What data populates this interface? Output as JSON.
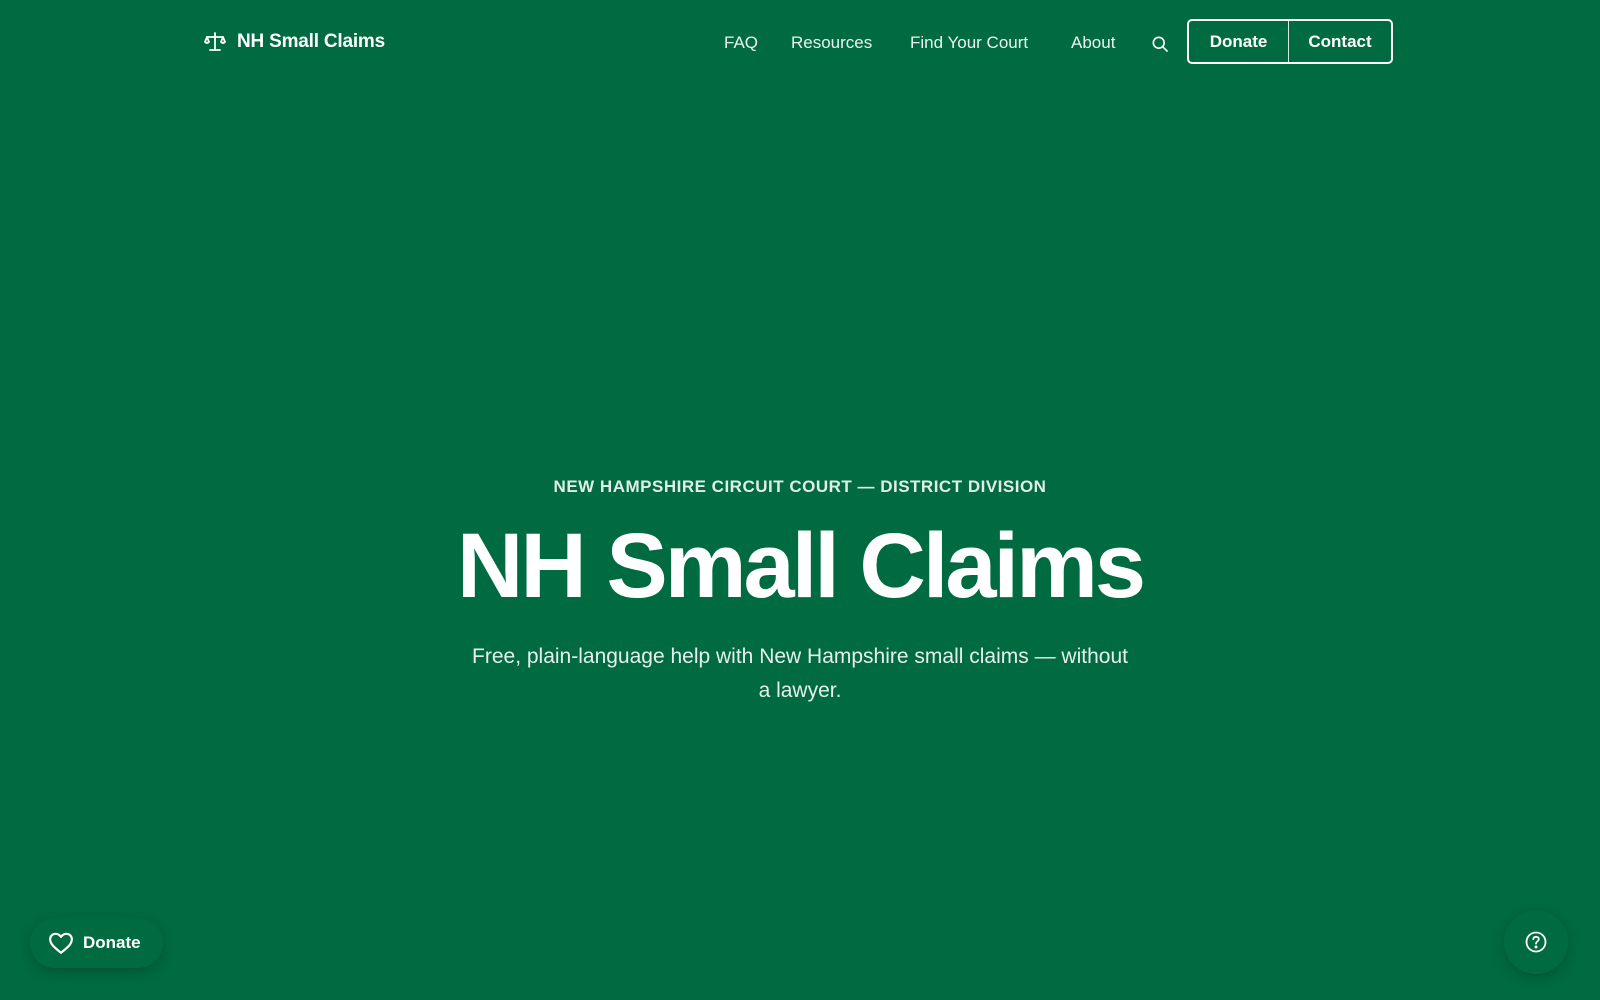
{
  "colors": {
    "background": "#006b40",
    "text": "#ffffff"
  },
  "header": {
    "brand": {
      "icon": "scales-of-justice-icon",
      "name": "NH Small Claims"
    },
    "nav": {
      "faq": "FAQ",
      "resources": "Resources",
      "find_court": "Find Your Court",
      "about": "About"
    },
    "search_icon": "search-icon",
    "buttons": {
      "donate": "Donate",
      "contact": "Contact"
    }
  },
  "hero": {
    "eyebrow": "NEW HAMPSHIRE CIRCUIT COURT — DISTRICT DIVISION",
    "title": "NH Small Claims",
    "subtitle": "Free, plain-language help with New Hampshire small claims — without a lawyer."
  },
  "floating": {
    "donate": {
      "icon": "heart-icon",
      "label": "Donate"
    },
    "help": {
      "icon": "help-circle-icon"
    }
  }
}
